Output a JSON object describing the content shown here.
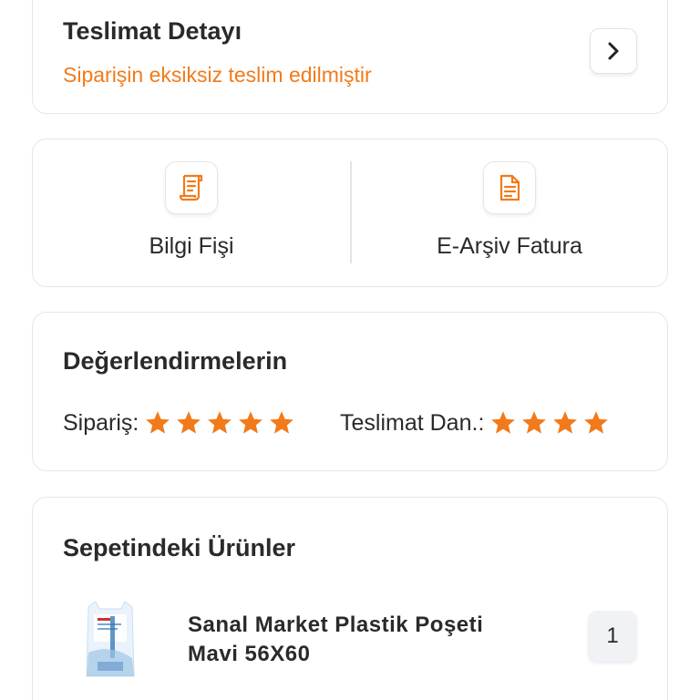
{
  "delivery": {
    "title": "Teslimat Detayı",
    "status": "Siparişin eksiksiz teslim edilmiştir",
    "status_color": "#f27a1a",
    "action_icon": "chevron-right-icon"
  },
  "documents": {
    "items": [
      {
        "label": "Bilgi Fişi",
        "icon": "receipt-icon"
      },
      {
        "label": "E-Arşiv Fatura",
        "icon": "invoice-document-icon"
      }
    ]
  },
  "reviews": {
    "title": "Değerlendirmelerin",
    "order_label": "Sipariş:",
    "order_stars": 5,
    "delivery_label": "Teslimat Dan.:",
    "delivery_stars": 4,
    "star_color": "#f27a1a"
  },
  "basket": {
    "title": "Sepetindeki Ürünler",
    "items": [
      {
        "name": "Sanal Market Plastik Poşeti Mavi 56X60",
        "quantity": "1",
        "image_icon": "plastic-bag-product-image"
      }
    ]
  },
  "colors": {
    "accent": "#f27a1a",
    "border": "#e6e6e6",
    "text": "#2a2a2a"
  }
}
